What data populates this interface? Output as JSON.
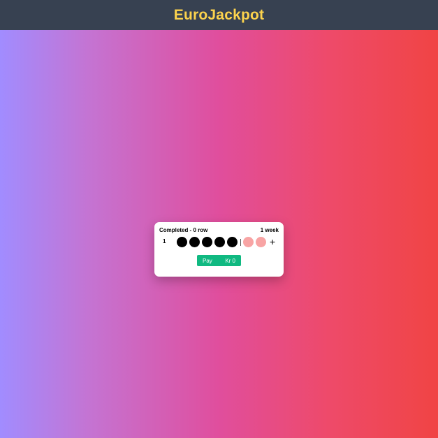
{
  "header": {
    "title": "EuroJackpot"
  },
  "card": {
    "status": "Completed - 0 row",
    "duration": "1 week",
    "rows": [
      {
        "number": "1",
        "main_balls": 5,
        "star_balls": 2
      }
    ],
    "plus_label": "+",
    "pay_label": "Pay",
    "amount": "Kr 0"
  },
  "colors": {
    "header_bg": "#374151",
    "title": "#fcd34d",
    "pay_button": "#10b981",
    "main_ball": "#000000",
    "star_ball": "#f8a4a4"
  }
}
